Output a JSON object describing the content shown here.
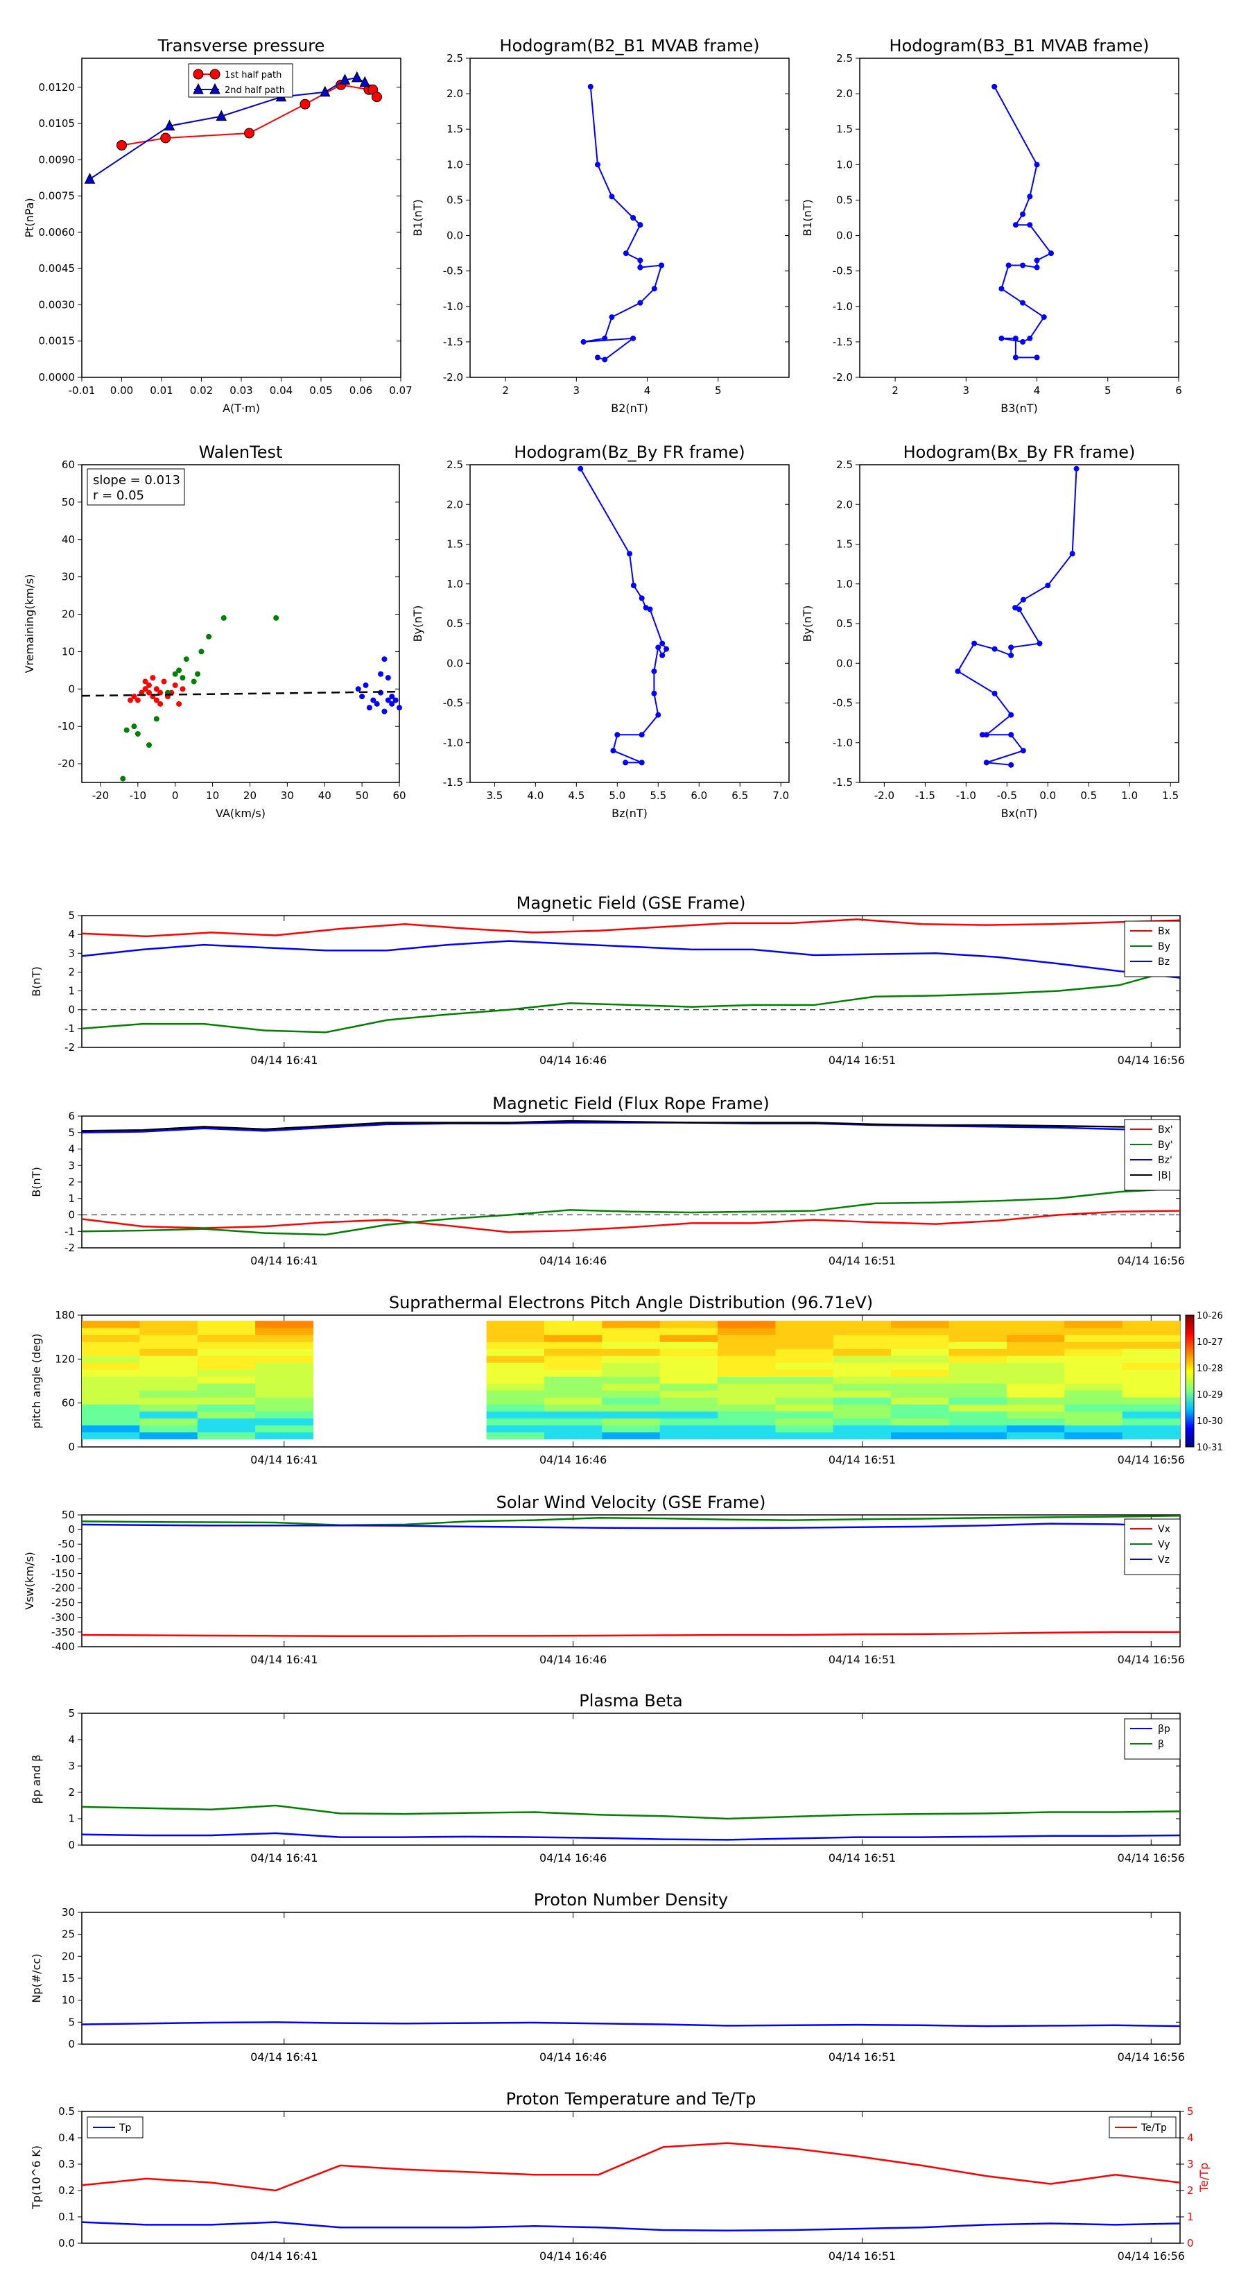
{
  "time_ticks": [
    "04/14 16:41",
    "04/14 16:46",
    "04/14 16:51",
    "04/14 16:56"
  ],
  "chart_data": [
    {
      "id": "transverse-pressure",
      "type": "line",
      "title": "Transverse pressure",
      "xlabel": "A(T·m)",
      "ylabel": "Pt(nPa)",
      "xlim": [
        -0.01,
        0.07
      ],
      "ylim": [
        0,
        0.0132
      ],
      "xticks": [
        "-0.01",
        "0.00",
        "0.01",
        "0.02",
        "0.03",
        "0.04",
        "0.05",
        "0.06",
        "0.07"
      ],
      "yticks": [
        "0.0000",
        "0.0015",
        "0.0030",
        "0.0045",
        "0.0060",
        "0.0075",
        "0.0090",
        "0.0105",
        "0.0120"
      ],
      "legend": "top-center",
      "series": [
        {
          "name": "1st half path",
          "color": "#ff0000",
          "marker": "circle",
          "x": [
            0.0,
            0.011,
            0.032,
            0.046,
            0.055,
            0.062,
            0.063,
            0.064
          ],
          "y": [
            0.0096,
            0.0099,
            0.0101,
            0.0113,
            0.0121,
            0.0119,
            0.0119,
            0.0116
          ]
        },
        {
          "name": "2nd half path",
          "color": "#0000cc",
          "marker": "triangle",
          "x": [
            -0.008,
            0.012,
            0.025,
            0.04,
            0.051,
            0.056,
            0.059,
            0.061
          ],
          "y": [
            0.0082,
            0.0104,
            0.0108,
            0.0116,
            0.0118,
            0.0123,
            0.0124,
            0.0122
          ]
        }
      ]
    },
    {
      "id": "hodogram-b2-b1",
      "type": "line",
      "title": "Hodogram(B2_B1 MVAB frame)",
      "xlabel": "B2(nT)",
      "ylabel": "B1(nT)",
      "xlim": [
        1.5,
        6.0
      ],
      "ylim": [
        -2.0,
        2.5
      ],
      "xticks": [
        "2",
        "3",
        "4",
        "5"
      ],
      "yticks": [
        "-2.0",
        "-1.5",
        "-1.0",
        "-0.5",
        "0.0",
        "0.5",
        "1.0",
        "1.5",
        "2.0",
        "2.5"
      ],
      "series": [
        {
          "color": "#0000ff",
          "marker": "dot",
          "x": [
            3.2,
            3.3,
            3.5,
            3.8,
            3.9,
            3.9,
            3.7,
            3.9,
            3.9,
            3.9,
            4.2,
            4.2,
            4.1,
            3.9,
            3.5,
            3.4,
            3.1,
            3.8,
            3.4,
            3.3
          ],
          "y": [
            2.1,
            1.0,
            0.55,
            0.25,
            0.15,
            0.15,
            -0.25,
            -0.35,
            -0.45,
            -0.45,
            -0.42,
            -0.42,
            -0.75,
            -0.95,
            -1.15,
            -1.45,
            -1.5,
            -1.45,
            -1.75,
            -1.72
          ]
        }
      ]
    },
    {
      "id": "hodogram-b3-b1",
      "type": "line",
      "title": "Hodogram(B3_B1 MVAB frame)",
      "xlabel": "B3(nT)",
      "ylabel": "B1(nT)",
      "xlim": [
        1.5,
        6.0
      ],
      "ylim": [
        -2.0,
        2.5
      ],
      "xticks": [
        "2",
        "3",
        "4",
        "5",
        "6"
      ],
      "yticks": [
        "-2.0",
        "-1.5",
        "-1.0",
        "-0.5",
        "0.0",
        "0.5",
        "1.0",
        "1.5",
        "2.0",
        "2.5"
      ],
      "series": [
        {
          "color": "#0000ff",
          "marker": "dot",
          "x": [
            3.4,
            4.0,
            3.9,
            3.8,
            3.7,
            3.9,
            4.2,
            4.0,
            4.0,
            3.8,
            3.6,
            3.5,
            3.8,
            4.1,
            3.9,
            3.8,
            3.5,
            3.7,
            3.7,
            4.0
          ],
          "y": [
            2.1,
            1.0,
            0.55,
            0.3,
            0.15,
            0.15,
            -0.25,
            -0.35,
            -0.45,
            -0.42,
            -0.42,
            -0.75,
            -0.95,
            -1.15,
            -1.45,
            -1.5,
            -1.45,
            -1.45,
            -1.72,
            -1.72
          ]
        }
      ]
    },
    {
      "id": "walen-test",
      "type": "scatter",
      "title": "WalenTest",
      "xlabel": "VA(km/s)",
      "ylabel": "Vremaining(km/s)",
      "xlim": [
        -25,
        60
      ],
      "ylim": [
        -25,
        60
      ],
      "xticks": [
        "-20",
        "-10",
        "0",
        "10",
        "20",
        "30",
        "40",
        "50",
        "60"
      ],
      "yticks": [
        "-20",
        "-10",
        "0",
        "10",
        "20",
        "30",
        "40",
        "50",
        "60"
      ],
      "annotation": [
        "slope = 0.013",
        "r = 0.05"
      ],
      "fit": {
        "slope": 0.013,
        "intercept": -1.5
      },
      "series": [
        {
          "color": "#ff0000",
          "x": [
            -12,
            -11,
            -10,
            -9,
            -8,
            -8,
            -7,
            -7,
            -6,
            -6,
            -5,
            -5,
            -4,
            -4,
            -3,
            -2,
            -1,
            0,
            1,
            2
          ],
          "y": [
            -3,
            -2,
            -3,
            -1,
            0,
            2,
            -1,
            1,
            -2,
            3,
            0,
            -3,
            -1,
            -4,
            2,
            -2,
            -1,
            1,
            -4,
            0
          ]
        },
        {
          "color": "#008000",
          "x": [
            -14,
            -13,
            -11,
            -10,
            -7,
            -5,
            -2,
            0,
            1,
            2,
            3,
            5,
            6,
            7,
            9,
            13,
            27
          ],
          "y": [
            -24,
            -11,
            -10,
            -12,
            -15,
            -8,
            -1,
            4,
            5,
            3,
            8,
            2,
            4,
            10,
            14,
            19,
            19
          ],
          "note": ""
        },
        {
          "color": "#0000ff",
          "x": [
            49,
            50,
            51,
            52,
            53,
            54,
            55,
            55,
            56,
            56,
            57,
            57,
            58,
            58,
            59,
            60
          ],
          "y": [
            0,
            -2,
            1,
            -5,
            -3,
            -4,
            4,
            -1,
            -6,
            8,
            -3,
            3,
            -4,
            -2,
            -3,
            -5
          ]
        }
      ]
    },
    {
      "id": "hodogram-bz-by",
      "type": "line",
      "title": "Hodogram(Bz_By FR frame)",
      "xlabel": "Bz(nT)",
      "ylabel": "By(nT)",
      "xlim": [
        3.2,
        7.1
      ],
      "ylim": [
        -1.5,
        2.5
      ],
      "xticks": [
        "3.5",
        "4.0",
        "4.5",
        "5.0",
        "5.5",
        "6.0",
        "6.5",
        "7.0"
      ],
      "yticks": [
        "-1.5",
        "-1.0",
        "-0.5",
        "0.0",
        "0.5",
        "1.0",
        "1.5",
        "2.0",
        "2.5"
      ],
      "series": [
        {
          "color": "#0000ff",
          "marker": "dot",
          "x": [
            4.55,
            5.15,
            5.2,
            5.3,
            5.35,
            5.4,
            5.55,
            5.6,
            5.55,
            5.5,
            5.45,
            5.45,
            5.5,
            5.3,
            5.0,
            4.95,
            5.3,
            5.1
          ],
          "y": [
            2.45,
            1.38,
            0.98,
            0.82,
            0.7,
            0.68,
            0.25,
            0.18,
            0.1,
            0.2,
            -0.1,
            -0.38,
            -0.65,
            -0.9,
            -0.9,
            -1.1,
            -1.25,
            -1.25
          ]
        }
      ]
    },
    {
      "id": "hodogram-bx-by",
      "type": "line",
      "title": "Hodogram(Bx_By FR frame)",
      "xlabel": "Bx(nT)",
      "ylabel": "By(nT)",
      "xlim": [
        -2.3,
        1.6
      ],
      "ylim": [
        -1.5,
        2.5
      ],
      "xticks": [
        "-2.0",
        "-1.5",
        "-1.0",
        "-0.5",
        "0.0",
        "0.5",
        "1.0",
        "1.5"
      ],
      "yticks": [
        "-1.5",
        "-1.0",
        "-0.5",
        "0.0",
        "0.5",
        "1.0",
        "1.5",
        "2.0",
        "2.5"
      ],
      "series": [
        {
          "color": "#0000ff",
          "marker": "dot",
          "x": [
            0.35,
            0.3,
            0.0,
            -0.3,
            -0.4,
            -0.35,
            -0.1,
            -0.45,
            -0.45,
            -0.65,
            -0.9,
            -1.1,
            -0.65,
            -0.45,
            -0.75,
            -0.8,
            -0.45,
            -0.3,
            -0.75,
            -0.45
          ],
          "y": [
            2.45,
            1.38,
            0.98,
            0.8,
            0.7,
            0.68,
            0.25,
            0.2,
            0.1,
            0.18,
            0.25,
            -0.1,
            -0.38,
            -0.65,
            -0.9,
            -0.9,
            -0.9,
            -1.1,
            -1.25,
            -1.28
          ]
        }
      ]
    },
    {
      "id": "mag-gse",
      "type": "line",
      "title": "Magnetic Field (GSE Frame)",
      "xlabel": "",
      "ylabel": "B(nT)",
      "ylim": [
        -2,
        5
      ],
      "yticks": [
        "-2",
        "-1",
        "0",
        "1",
        "2",
        "3",
        "4",
        "5"
      ],
      "zero_line": true,
      "legend": "top-right",
      "series": [
        {
          "name": "Bx",
          "color": "#ff0000",
          "y": [
            4.05,
            3.9,
            4.1,
            3.95,
            4.3,
            4.55,
            4.3,
            4.1,
            4.2,
            4.4,
            4.6,
            4.6,
            4.8,
            4.55,
            4.5,
            4.55,
            4.65,
            4.75
          ]
        },
        {
          "name": "By",
          "color": "#008000",
          "y": [
            -1.0,
            -0.75,
            -0.75,
            -1.1,
            -1.2,
            -0.55,
            -0.25,
            0.0,
            0.35,
            0.25,
            0.15,
            0.25,
            0.25,
            0.7,
            0.75,
            0.85,
            1.0,
            1.3,
            2.2
          ]
        },
        {
          "name": "Bz",
          "color": "#0000ff",
          "y": [
            2.85,
            3.2,
            3.45,
            3.3,
            3.15,
            3.15,
            3.45,
            3.65,
            3.5,
            3.35,
            3.2,
            3.2,
            2.9,
            2.95,
            3.0,
            2.8,
            2.45,
            2.05,
            1.7
          ]
        }
      ]
    },
    {
      "id": "mag-fr",
      "type": "line",
      "title": "Magnetic Field (Flux Rope Frame)",
      "xlabel": "",
      "ylabel": "B(nT)",
      "ylim": [
        -2,
        6
      ],
      "yticks": [
        "-2",
        "-1",
        "0",
        "1",
        "2",
        "3",
        "4",
        "5",
        "6"
      ],
      "zero_line": true,
      "legend": "top-right",
      "series": [
        {
          "name": "Bx'",
          "color": "#ff0000",
          "y": [
            -0.25,
            -0.7,
            -0.8,
            -0.7,
            -0.45,
            -0.3,
            -0.65,
            -1.05,
            -0.95,
            -0.75,
            -0.5,
            -0.5,
            -0.3,
            -0.45,
            -0.55,
            -0.35,
            0.0,
            0.2,
            0.25
          ]
        },
        {
          "name": "By'",
          "color": "#008000",
          "y": [
            -1.0,
            -0.95,
            -0.85,
            -1.1,
            -1.2,
            -0.6,
            -0.25,
            0.0,
            0.3,
            0.2,
            0.15,
            0.2,
            0.25,
            0.7,
            0.75,
            0.85,
            1.0,
            1.4,
            1.6
          ]
        },
        {
          "name": "Bz'",
          "color": "#0000ff",
          "y": [
            5.0,
            5.05,
            5.25,
            5.1,
            5.3,
            5.5,
            5.55,
            5.55,
            5.6,
            5.6,
            5.6,
            5.55,
            5.55,
            5.45,
            5.4,
            5.35,
            5.3,
            5.2,
            5.1
          ]
        },
        {
          "name": "|B|",
          "color": "#000000",
          "y": [
            5.1,
            5.15,
            5.35,
            5.2,
            5.4,
            5.6,
            5.6,
            5.6,
            5.7,
            5.65,
            5.6,
            5.6,
            5.6,
            5.5,
            5.45,
            5.45,
            5.4,
            5.35,
            5.3
          ]
        }
      ]
    },
    {
      "id": "pad",
      "type": "heatmap",
      "title": "Suprathermal Electrons Pitch Angle Distribution (96.71eV)",
      "ylabel": "pitch angle (deg)",
      "ylim": [
        0,
        180
      ],
      "yticks": [
        "0",
        "60",
        "120",
        "180"
      ],
      "colorbar": {
        "ticks": [
          "10-31",
          "10-30",
          "10-29",
          "10-28",
          "10-27",
          "10-26"
        ]
      },
      "gap": [
        5.2,
        11.0
      ]
    },
    {
      "id": "vsw",
      "type": "line",
      "title": "Solar Wind Velocity (GSE Frame)",
      "ylabel": "Vsw(km/s)",
      "ylim": [
        -400,
        50
      ],
      "yticks": [
        "-400",
        "-350",
        "-300",
        "-250",
        "-200",
        "-150",
        "-100",
        "-50",
        "0",
        "50"
      ],
      "legend": "top-right",
      "series": [
        {
          "name": "Vx",
          "color": "#ff0000",
          "y": [
            -360,
            -361,
            -362,
            -363,
            -364,
            -364,
            -363,
            -363,
            -362,
            -361,
            -360,
            -360,
            -358,
            -357,
            -355,
            -352,
            -350,
            -350
          ]
        },
        {
          "name": "Vy",
          "color": "#008000",
          "y": [
            28,
            26,
            25,
            24,
            15,
            17,
            28,
            32,
            40,
            38,
            34,
            32,
            35,
            37,
            40,
            42,
            44,
            47
          ]
        },
        {
          "name": "Vz",
          "color": "#0000ff",
          "y": [
            17,
            15,
            14,
            14,
            14,
            13,
            10,
            8,
            6,
            5,
            5,
            6,
            8,
            10,
            14,
            20,
            18,
            10
          ]
        }
      ]
    },
    {
      "id": "beta",
      "type": "line",
      "title": "Plasma Beta",
      "ylabel": "βp and β",
      "ylim": [
        0,
        5
      ],
      "yticks": [
        "0",
        "1",
        "2",
        "3",
        "4",
        "5"
      ],
      "legend": "top-right",
      "series": [
        {
          "name": "βp",
          "color": "#0000ff",
          "y": [
            0.4,
            0.37,
            0.37,
            0.45,
            0.3,
            0.3,
            0.32,
            0.3,
            0.27,
            0.22,
            0.2,
            0.25,
            0.3,
            0.3,
            0.32,
            0.35,
            0.35,
            0.37
          ]
        },
        {
          "name": "β",
          "color": "#008000",
          "y": [
            1.45,
            1.4,
            1.35,
            1.5,
            1.2,
            1.18,
            1.22,
            1.25,
            1.15,
            1.1,
            1.0,
            1.08,
            1.15,
            1.18,
            1.2,
            1.25,
            1.25,
            1.28
          ]
        }
      ]
    },
    {
      "id": "density",
      "type": "line",
      "title": "Proton Number Density",
      "ylabel": "Np(#/cc)",
      "ylim": [
        0,
        30
      ],
      "yticks": [
        "0",
        "5",
        "10",
        "15",
        "20",
        "25",
        "30"
      ],
      "series": [
        {
          "color": "#0000ff",
          "y": [
            4.5,
            4.7,
            4.9,
            5.0,
            4.8,
            4.7,
            4.8,
            4.9,
            4.7,
            4.5,
            4.2,
            4.3,
            4.4,
            4.3,
            4.1,
            4.2,
            4.3,
            4.1
          ]
        }
      ]
    },
    {
      "id": "temperature",
      "type": "line",
      "title": "Proton Temperature and Te/Tp",
      "ylabel": "Tp(10^6 K)",
      "ylabel_right": "Te/Tp",
      "ylim": [
        0,
        0.5
      ],
      "ylim_right": [
        0,
        5
      ],
      "yticks": [
        "0.0",
        "0.1",
        "0.2",
        "0.3",
        "0.4",
        "0.5"
      ],
      "yticks_right": [
        "0",
        "1",
        "2",
        "3",
        "4",
        "5"
      ],
      "series": [
        {
          "name": "Tp",
          "color": "#0000ff",
          "axis": "left",
          "y": [
            0.08,
            0.07,
            0.07,
            0.08,
            0.06,
            0.06,
            0.06,
            0.065,
            0.06,
            0.05,
            0.048,
            0.05,
            0.055,
            0.06,
            0.07,
            0.075,
            0.07,
            0.075
          ]
        },
        {
          "name": "Te/Tp",
          "color": "#ff0000",
          "axis": "right",
          "y": [
            2.2,
            2.45,
            2.3,
            2.0,
            2.95,
            2.8,
            2.7,
            2.6,
            2.6,
            3.65,
            3.8,
            3.6,
            3.3,
            2.95,
            2.55,
            2.25,
            2.6,
            2.3
          ]
        }
      ]
    }
  ]
}
